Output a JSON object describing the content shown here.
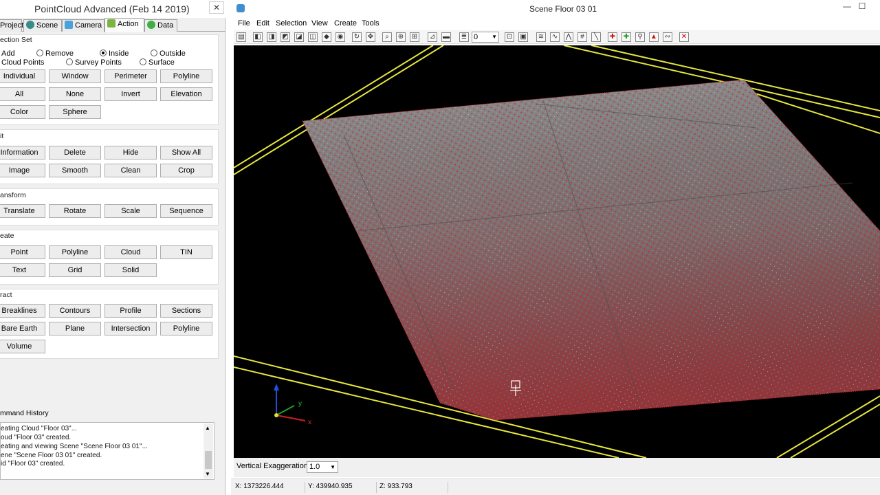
{
  "panel": {
    "title": "PointCloud Advanced (Feb 14 2019)",
    "close_glyph": "✕",
    "tabs": [
      {
        "label": "Project",
        "icon": "project-icon",
        "color": "#7a7a7a"
      },
      {
        "label": "Scene",
        "icon": "scene-globe-icon",
        "color": "#3a8a8a"
      },
      {
        "label": "Camera",
        "icon": "camera-icon",
        "color": "#4aa3d8"
      },
      {
        "label": "Action",
        "icon": "action-icon",
        "color": "#7cb342"
      },
      {
        "label": "Data",
        "icon": "data-icon",
        "color": "#3cb043"
      }
    ],
    "selection": {
      "label": "ection Set",
      "mode_options": [
        "Add",
        "Remove",
        "Inside",
        "Outside"
      ],
      "target_options": [
        "Cloud Points",
        "Survey Points",
        "Surface"
      ],
      "selected_mode": "Inside",
      "buttons": [
        "Individual",
        "Window",
        "Perimeter",
        "Polyline",
        "All",
        "None",
        "Invert",
        "Elevation",
        "Color",
        "Sphere"
      ]
    },
    "edit": {
      "label": "it",
      "buttons": [
        "Information",
        "Delete",
        "Hide",
        "Show All",
        "Image",
        "Smooth",
        "Clean",
        "Crop"
      ]
    },
    "transform": {
      "label": "ansform",
      "buttons": [
        "Translate",
        "Rotate",
        "Scale",
        "Sequence"
      ]
    },
    "create": {
      "label": "eate",
      "buttons": [
        "Point",
        "Polyline",
        "Cloud",
        "TIN",
        "Text",
        "Grid",
        "Solid"
      ]
    },
    "extract": {
      "label": "ract",
      "buttons": [
        "Breaklines",
        "Contours",
        "Profile",
        "Sections",
        "Bare Earth",
        "Plane",
        "Intersection",
        "Polyline",
        "Volume"
      ]
    },
    "history": {
      "label": "mmand History",
      "lines": [
        "eating Cloud \"Floor 03\"...",
        "oud \"Floor 03\" created.",
        "eating and viewing Scene \"Scene Floor 03 01\"...",
        "ene \"Scene Floor 03 01\" created.",
        "id \"Floor 03\" created."
      ]
    }
  },
  "scene": {
    "title": "Scene Floor 03 01",
    "menu": [
      "File",
      "Edit",
      "Selection",
      "View",
      "Create",
      "Tools"
    ],
    "toolbar_value": "0",
    "vertical_exaggeration_label": "Vertical Exaggeration",
    "vertical_exaggeration_value": "1.0",
    "axes": {
      "y": "y",
      "x": "x"
    },
    "coords": {
      "x": "X: 1373226.444",
      "y": "Y: 439940.935",
      "z": "Z: 933.793"
    },
    "colors": {
      "boundary": "#e6e63c",
      "points": "#d0202a",
      "floor": "#8c8c8c"
    }
  }
}
